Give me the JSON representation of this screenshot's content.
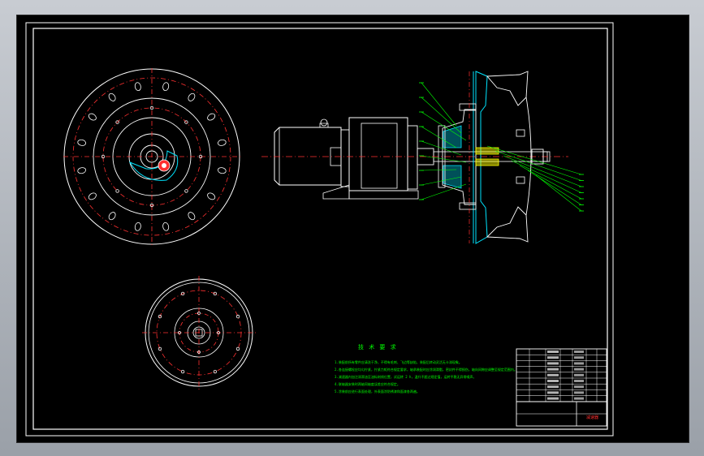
{
  "drawing": {
    "notes_title": "技 术 要 求",
    "notes": [
      "1.装配前所有零件应清洗干净，不得有毛刺、飞边等缺陷，装配后转动灵活无卡滞现象。",
      "2.各连接螺栓应均匀拧紧，拧紧力矩符合规定要求，轴承装配时应涂润滑脂，密封件不得损伤，轴向间隙应调整至规定范围内。",
      "3.减速器内加注润滑油至油标刻线位置，试运转 2 h，温升不超过规定值，运转平稳无异常噪声。",
      "4.联轴器安装时两轴同轴度误差应符合规定。",
      "5.涂装前应进行表面处理，外表面涂防锈漆和面漆各两遍。"
    ],
    "title_block_label": "减速器"
  },
  "colors": {
    "line": "#ffffff",
    "center": "#ff3030",
    "section": "#00e5ff",
    "leader": "#00ff00",
    "accent": "#ffff00",
    "text": "#00ff00"
  }
}
